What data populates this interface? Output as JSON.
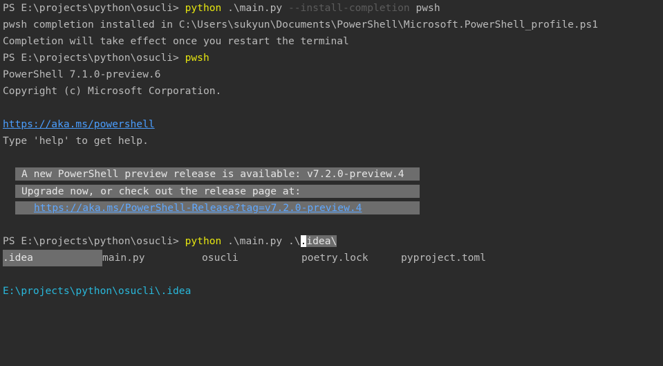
{
  "lines": {
    "l1": {
      "prompt": "PS E:\\projects\\python\\osucli> ",
      "cmd": "python",
      "arg": " .\\main.py ",
      "dim": "--install-completion",
      "tail": " pwsh"
    },
    "l2": "pwsh completion installed in C:\\Users\\sukyun\\Documents\\PowerShell\\Microsoft.PowerShell_profile.ps1",
    "l3": "Completion will take effect once you restart the terminal",
    "l4": {
      "prompt": "PS E:\\projects\\python\\osucli> ",
      "cmd": "pwsh"
    },
    "l5": "PowerShell 7.1.0-preview.6",
    "l6": "Copyright (c) Microsoft Corporation.",
    "l7": "https://aka.ms/powershell",
    "l8": "Type 'help' to get help.",
    "notice": {
      "line1": "A new PowerShell preview release is available: v7.2.0-preview.4",
      "line2": "Upgrade now, or check out the release page at:",
      "link": "https://aka.ms/PowerShell-Release?tag=v7.2.0-preview.4"
    },
    "l9": {
      "prompt": "PS E:\\projects\\python\\osucli> ",
      "cmd": "python",
      "arg": " .\\main.py .\\",
      "cursor": ".",
      "sel": "idea\\"
    },
    "completions": [
      ".idea",
      "main.py",
      "osucli",
      "poetry.lock",
      "pyproject.toml"
    ],
    "l10": "E:\\projects\\python\\osucli\\.idea"
  },
  "colors": {
    "background": "#2b2b2b",
    "text": "#bbbbbb",
    "command": "#e5e510",
    "link": "#4a9eff",
    "path_output": "#29b8db",
    "notice_bg": "#6d6d6d"
  }
}
